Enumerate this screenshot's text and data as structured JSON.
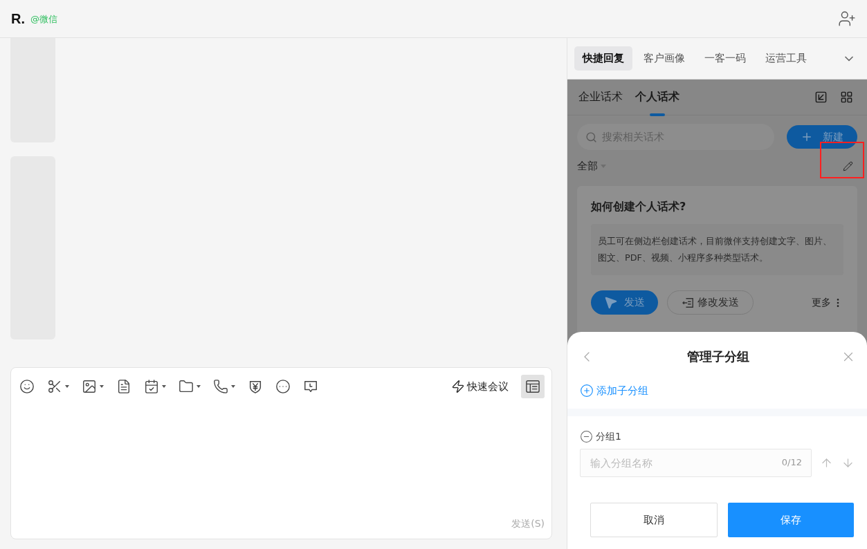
{
  "header": {
    "title": "R.",
    "source": "@微信"
  },
  "composer": {
    "tools": [
      {
        "kind": "emoji",
        "has_menu": false
      },
      {
        "kind": "scissors",
        "has_menu": true
      },
      {
        "kind": "image",
        "has_menu": true
      },
      {
        "kind": "document",
        "has_menu": false
      },
      {
        "kind": "calendar",
        "has_menu": true
      },
      {
        "kind": "folder",
        "has_menu": true
      },
      {
        "kind": "phone",
        "has_menu": true
      },
      {
        "kind": "yen",
        "has_menu": false
      },
      {
        "kind": "more",
        "has_menu": false
      },
      {
        "kind": "message",
        "has_menu": false
      }
    ],
    "quick_meeting": "快速会议",
    "send": "发送(S)"
  },
  "side_tabs": [
    {
      "label": "快捷回复",
      "selected": true
    },
    {
      "label": "客户画像",
      "selected": false
    },
    {
      "label": "一客一码",
      "selected": false
    },
    {
      "label": "运营工具",
      "selected": false
    }
  ],
  "script_tabs": [
    {
      "label": "企业话术",
      "selected": false
    },
    {
      "label": "个人话术",
      "selected": true
    }
  ],
  "search": {
    "placeholder": "搜索相关话术"
  },
  "new_button": "新建",
  "filter": "全部",
  "card": {
    "title": "如何创建个人话术?",
    "body": "员工可在侧边栏创建话术，目前微伴支持创建文字、图片、图文、PDF、视频、小程序多种类型话术。",
    "send": "发送",
    "edit_send": "修改发送",
    "more": "更多"
  },
  "sheet": {
    "title": "管理子分组",
    "add": "添加子分组",
    "groups": [
      {
        "name": "分组1",
        "placeholder": "输入分组名称",
        "counter": "0/12"
      }
    ],
    "cancel": "取消",
    "save": "保存"
  }
}
